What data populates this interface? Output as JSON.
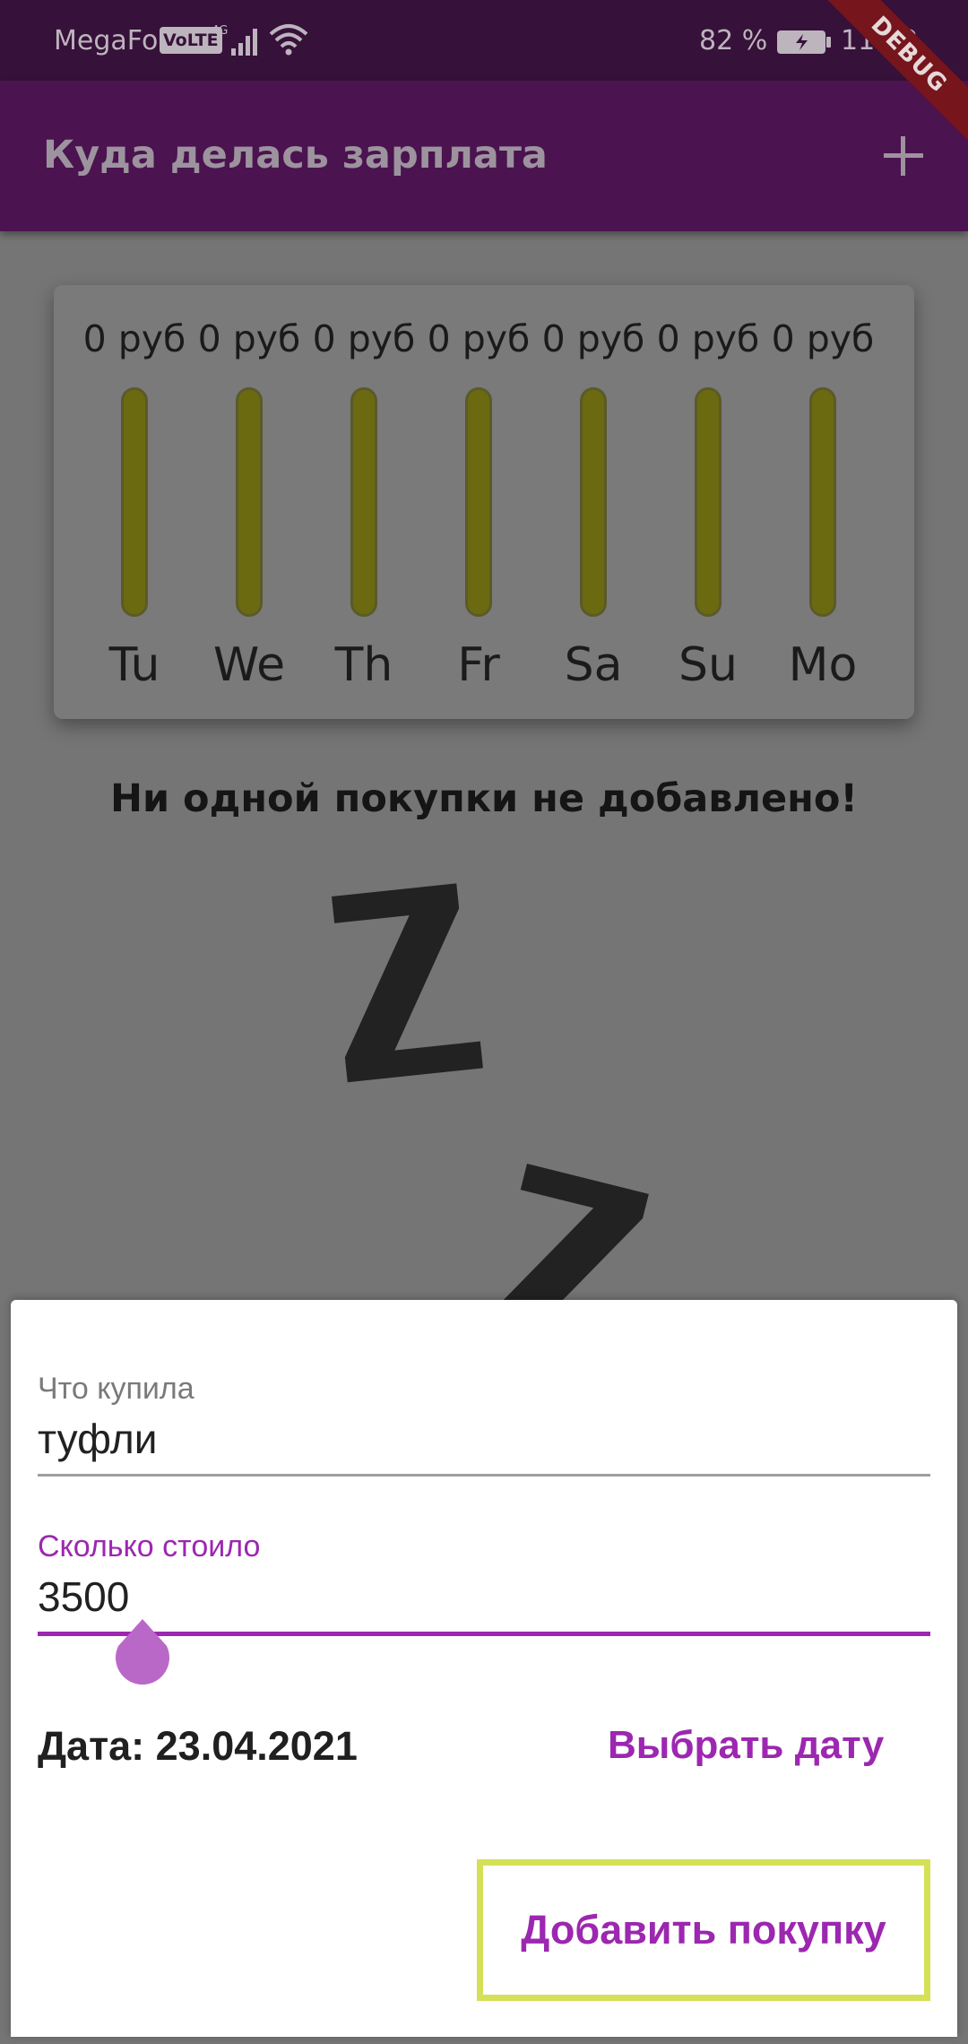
{
  "status_bar": {
    "carrier": "MegaFon",
    "volte": "VoLTE",
    "battery": "82 %",
    "clock": "11:02",
    "debug_banner": "DEBUG"
  },
  "app_bar": {
    "title": "Куда делась зарплата",
    "add_icon": "plus-icon"
  },
  "chart": {
    "bars": [
      {
        "day": "Tu",
        "amount": "0 руб",
        "fraction": 0
      },
      {
        "day": "We",
        "amount": "0 руб",
        "fraction": 0
      },
      {
        "day": "Th",
        "amount": "0 руб",
        "fraction": 0
      },
      {
        "day": "Fr",
        "amount": "0 руб",
        "fraction": 0
      },
      {
        "day": "Sa",
        "amount": "0 руб",
        "fraction": 0
      },
      {
        "day": "Su",
        "amount": "0 руб",
        "fraction": 0
      },
      {
        "day": "Mo",
        "amount": "0 руб",
        "fraction": 0
      }
    ]
  },
  "empty_state": {
    "message": "Ни одной покупки не добавлено!",
    "image": "sleeping-zzz-image"
  },
  "form": {
    "title_field": {
      "label": "Что купила",
      "value": "туфли"
    },
    "amount_field": {
      "label": "Сколько стоило",
      "value": "3500"
    },
    "date_label": "Дата:  23.04.2021",
    "choose_date_button": "Выбрать дату",
    "submit_button": "Добавить покупку"
  },
  "colors": {
    "accent": "#9c27b0",
    "app_bar": "#4b1350",
    "status_bar": "#361139",
    "bar_fill": "#6c6a11",
    "highlight": "#d4e157"
  }
}
